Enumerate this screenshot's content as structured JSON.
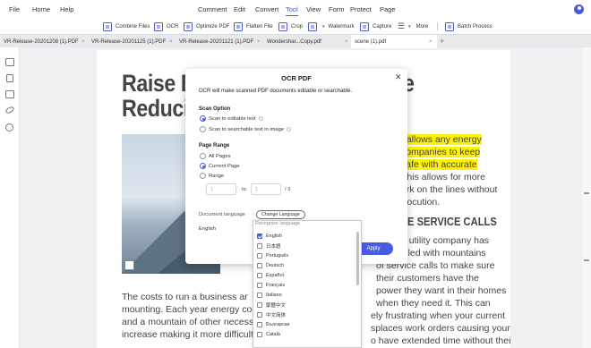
{
  "menubar": {
    "items": [
      "File",
      "Home",
      "Help",
      "Comment",
      "Edit",
      "Convert",
      "Tool",
      "View",
      "Form",
      "Protect",
      "Page"
    ],
    "active": "Tool"
  },
  "toolbar": {
    "tools": [
      {
        "label": "Combine Files",
        "icon": "combine-files-icon"
      },
      {
        "label": "OCR",
        "icon": "ocr-icon"
      },
      {
        "label": "Optimize PDF",
        "icon": "optimize-pdf-icon"
      },
      {
        "label": "Flatten File",
        "icon": "flatten-file-icon"
      },
      {
        "label": "Crop",
        "icon": "crop-icon"
      },
      {
        "label": "Watermark",
        "icon": "watermark-icon"
      },
      {
        "label": "Capture",
        "icon": "capture-icon"
      },
      {
        "label": "More",
        "icon": "more-icon"
      },
      {
        "label": "Batch Process",
        "icon": "batch-process-icon"
      }
    ]
  },
  "tabs": [
    {
      "label": "VR-Release-20201208 (1).PDF"
    },
    {
      "label": "VR-Release-20201125 (1).PDF"
    },
    {
      "label": "VR-Release-20201121 (1).PDF"
    },
    {
      "label": "Wondershar...Copy.pdf"
    },
    {
      "label": "scene (1).pdf"
    }
  ],
  "document": {
    "title_line1": "Raise Er",
    "title_line1_end": "e",
    "title_line2": "Reducin",
    "right_col": [
      "t allows any energy",
      "companies to keep",
      "safe with accurate",
      "This allows for more",
      "ork on the lines without",
      "trocution."
    ],
    "right_heading": "E SERVICE CALLS",
    "right_col2": [
      "e utility company has",
      "filled with mountains",
      "of service calls to make sure",
      "their    customers    have    the",
      "power they want in their homes",
      "when they need it. This can",
      "ely frustrating when your current",
      "splaces work orders causing your",
      "o have extended time without their"
    ],
    "body_lines": [
      "The costs to run a business ar",
      "mounting. Each year energy costs,",
      "and a mountain of other necess",
      "increase making it more difficult t"
    ]
  },
  "ocr_dialog": {
    "title": "OCR PDF",
    "description": "OCR will make scanned PDF documents editable or searchable.",
    "scan_option_label": "Scan Option",
    "scan_options": [
      "Scan to editable text",
      "Scan to searchable text in image"
    ],
    "page_range_label": "Page Range",
    "page_ranges": [
      "All Pages",
      "Current Page",
      "Range"
    ],
    "range_from": "1",
    "range_to_label": "to",
    "range_to": "1",
    "range_total": "/ 3",
    "document_language_label": "Document language",
    "change_language_label": "Change Language",
    "current_language": "English",
    "apply_label": "Apply"
  },
  "language_dropdown": {
    "header": "Recognize language",
    "options": [
      {
        "label": "English",
        "checked": true
      },
      {
        "label": "日本語",
        "checked": false
      },
      {
        "label": "Português",
        "checked": false
      },
      {
        "label": "Deutsch",
        "checked": false
      },
      {
        "label": "Español",
        "checked": false
      },
      {
        "label": "Français",
        "checked": false
      },
      {
        "label": "Italiano",
        "checked": false
      },
      {
        "label": "繁體中文",
        "checked": false
      },
      {
        "label": "中文简体",
        "checked": false
      },
      {
        "label": "Български",
        "checked": false
      },
      {
        "label": "Català",
        "checked": false
      }
    ]
  },
  "colors": {
    "accent": "#4a5be0",
    "highlight": "#fff200"
  }
}
